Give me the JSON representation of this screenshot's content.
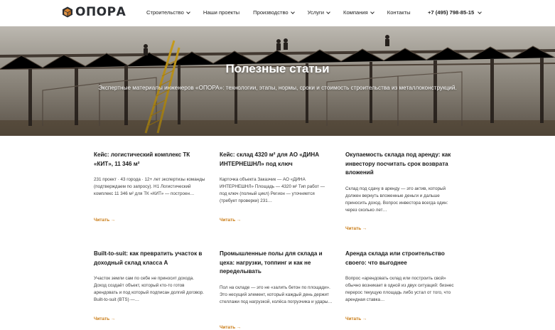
{
  "header": {
    "logo_text": "ОПОРА",
    "nav": [
      {
        "label": "Строительство",
        "dropdown": true
      },
      {
        "label": "Наши проекты",
        "dropdown": false
      },
      {
        "label": "Производство",
        "dropdown": true
      },
      {
        "label": "Услуги",
        "dropdown": true
      },
      {
        "label": "Компания",
        "dropdown": true
      },
      {
        "label": "Контакты",
        "dropdown": false
      }
    ],
    "phone": "+7 (495) 798-85-15"
  },
  "hero": {
    "title": "Полезные статьи",
    "subtitle": "Экспертные материалы инженеров «ОПОРА»: технологии, этапы, нормы, сроки и стоимость строительства из металлоконструкций."
  },
  "articles": [
    {
      "title": "Кейс: логистический комплекс ТК «КИТ», 11 346 м²",
      "excerpt": "231 проект · 43 города · 12+ лет экспертизы команды (подтверждаем по запросу). Н1 Логистический комплекс 11 346 м² для ТК «КИТ» — построен…",
      "link": "Читать →"
    },
    {
      "title": "Кейс: склад 4320 м² для АО «ДИНА ИНТЕРНЕШНЛ» под ключ",
      "excerpt": "Карточка объекта Заказчик — АО «ДИНА ИНТЕРНЕШНЛ» Площадь — 4320 м² Тип работ — под ключ (полный цикл) Регион — уточняется (требует проверки) 231…",
      "link": "Читать →"
    },
    {
      "title": "Окупаемость склада под аренду: как инвестору посчитать срок возврата вложений",
      "excerpt": "Склад под сдачу в аренду — это актив, который должен вернуть вложенные деньги и дальше приносить доход. Вопрос инвестора всегда один: через сколько лет…",
      "link": "Читать →"
    },
    {
      "title": "Built-to-suit: как превратить участок в доходный склад класса А",
      "excerpt": "Участок земли сам по себе не приносит дохода. Доход создаёт объект, который кто-то готов арендовать и под который подписан долгий договор. Built-to-suit (BTS) —…",
      "link": "Читать →"
    },
    {
      "title": "Промышленные полы для склада и цеха: нагрузки, топпинг и как не переделывать",
      "excerpt": "Пол на складе — это не «залить бетон по площади». Это несущий элемент, который каждый день держит стеллажи под нагрузкой, колёса погрузчика и удары…",
      "link": "Читать →"
    },
    {
      "title": "Аренда склада или строительство своего: что выгоднее",
      "excerpt": "Вопрос «арендовать склад или построить свой» обычно возникает в одной из двух ситуаций: бизнес перерос текущую площадь либо устал от того, что арендная ставка…",
      "link": "Читать →"
    }
  ],
  "colors": {
    "accent": "#c97a12",
    "logo_orange": "#d9822b",
    "logo_dark": "#2b2e33"
  }
}
